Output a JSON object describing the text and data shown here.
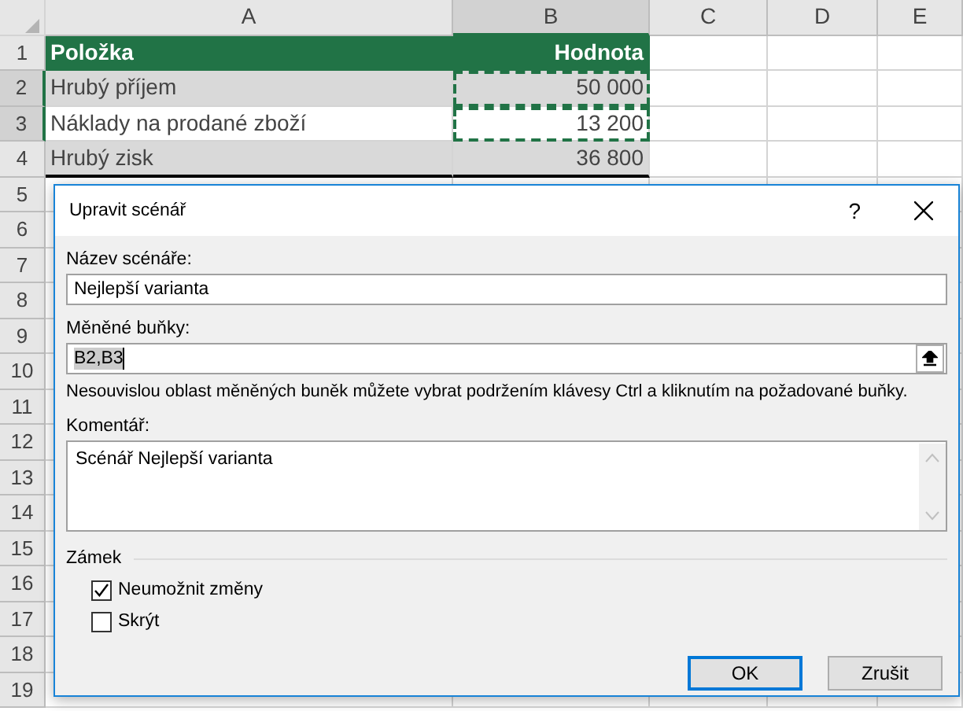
{
  "sheet": {
    "columns": [
      {
        "label": "A",
        "selected": false
      },
      {
        "label": "B",
        "selected": true
      },
      {
        "label": "C",
        "selected": false
      },
      {
        "label": "D",
        "selected": false
      },
      {
        "label": "E",
        "selected": false
      }
    ],
    "rows": [
      {
        "number": "1",
        "selected": false,
        "kind": "header",
        "marquee": false,
        "cells": [
          "Položka",
          "Hodnota"
        ]
      },
      {
        "number": "2",
        "selected": true,
        "kind": "band",
        "marquee": true,
        "cells": [
          "Hrubý příjem",
          "50 000"
        ]
      },
      {
        "number": "3",
        "selected": true,
        "kind": "plain",
        "marquee": true,
        "cells": [
          "Náklady na prodané zboží",
          "13 200"
        ]
      },
      {
        "number": "4",
        "selected": false,
        "kind": "band",
        "marquee": false,
        "cells": [
          "Hrubý zisk",
          "36 800"
        ]
      },
      {
        "number": "5",
        "selected": false
      },
      {
        "number": "6",
        "selected": false
      },
      {
        "number": "7",
        "selected": false
      },
      {
        "number": "8",
        "selected": false
      },
      {
        "number": "9",
        "selected": false
      },
      {
        "number": "10",
        "selected": false
      },
      {
        "number": "11",
        "selected": false
      },
      {
        "number": "12",
        "selected": false
      },
      {
        "number": "13",
        "selected": false
      },
      {
        "number": "14",
        "selected": false
      },
      {
        "number": "15",
        "selected": false
      },
      {
        "number": "16",
        "selected": false
      },
      {
        "number": "17",
        "selected": false
      },
      {
        "number": "18",
        "selected": false
      },
      {
        "number": "19",
        "selected": false
      }
    ]
  },
  "dialog": {
    "title": "Upravit scénář",
    "help": "?",
    "name_label": "Název scénáře:",
    "name_value": "Nejlepší varianta",
    "cells_label": "Měněné buňky:",
    "cells_value": "B2,B3",
    "hint": "Nesouvislou oblast měněných buněk můžete vybrat podržením klávesy Ctrl a kliknutím na požadované buňky.",
    "comment_label": "Komentář:",
    "comment_value": "Scénář Nejlepší varianta",
    "group_label": "Zámek",
    "checkboxes": [
      {
        "label": "Neumožnit změny",
        "checked": true
      },
      {
        "label": "Skrýt",
        "checked": false
      }
    ],
    "buttons": [
      {
        "label": "OK",
        "default": true
      },
      {
        "label": "Zrušit",
        "default": false
      }
    ]
  }
}
